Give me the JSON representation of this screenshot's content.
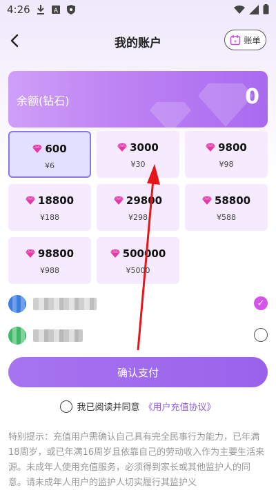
{
  "status_bar": {
    "time": "4:26"
  },
  "header": {
    "title": "我的账户",
    "bill_label": "账单"
  },
  "balance": {
    "label": "余额(钻石)",
    "value": "0"
  },
  "packages": [
    {
      "amount": "600",
      "price": "¥6",
      "selected": true
    },
    {
      "amount": "3000",
      "price": "¥30",
      "selected": false
    },
    {
      "amount": "9800",
      "price": "¥98",
      "selected": false
    },
    {
      "amount": "18800",
      "price": "¥188",
      "selected": false
    },
    {
      "amount": "29800",
      "price": "¥298",
      "selected": false
    },
    {
      "amount": "58800",
      "price": "¥588",
      "selected": false
    },
    {
      "amount": "98800",
      "price": "¥988",
      "selected": false
    },
    {
      "amount": "500000",
      "price": "¥5000",
      "selected": false
    }
  ],
  "payment_methods": [
    {
      "selected": true
    },
    {
      "selected": false
    }
  ],
  "confirm_label": "确认支付",
  "agreement": {
    "text": "我已阅读并同意",
    "link": "《用户充值协议》"
  },
  "notice": "特别提示：充值用户需确认自己具有完全民事行为能力，已年满18周岁，或已年满16周岁且依靠自己的劳动收入作为主要生活来源。未成年人使用充值服务，必须得到家长或其他监护人的同意。请未成年人用户的监护人切实履行其监护义",
  "colors": {
    "accent": "#9a62ea",
    "gem": "#e03aa8",
    "link": "#8f5be0",
    "check": "#d553e8"
  }
}
